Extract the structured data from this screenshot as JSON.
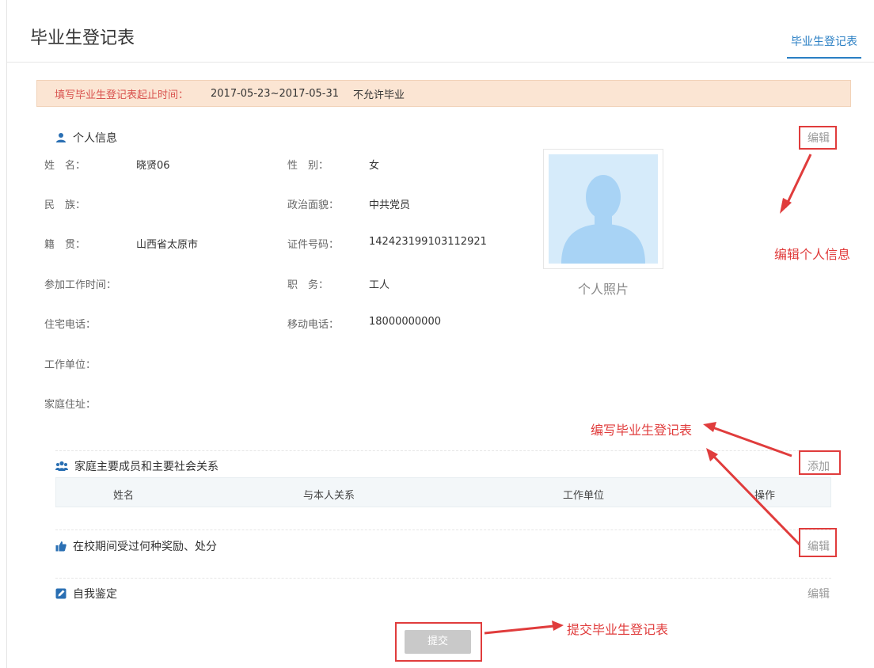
{
  "page": {
    "title": "毕业生登记表",
    "tab": "毕业生登记表"
  },
  "notice": {
    "label": "填写毕业生登记表起止时间：",
    "dates": "2017-05-23~2017-05-31",
    "status": "不允许毕业"
  },
  "personal": {
    "heading": "个人信息",
    "edit": "编辑",
    "photo_caption": "个人照片",
    "fields": {
      "name_label": "姓　名：",
      "name_value": "晓贤06",
      "gender_label": "性　别：",
      "gender_value": "女",
      "ethnicity_label": "民　族：",
      "politics_label": "政治面貌：",
      "politics_value": "中共党员",
      "origin_label": "籍　贯：",
      "origin_value": "山西省太原市",
      "id_label": "证件号码：",
      "id_value": "142423199103112921",
      "work_start_label": "参加工作时间：",
      "position_label": "职　务：",
      "position_value": "工人",
      "home_phone_label": "住宅电话：",
      "mobile_label": "移动电话：",
      "mobile_value": "18000000000",
      "employer_label": "工作单位：",
      "address_label": "家庭住址："
    }
  },
  "family": {
    "heading": "家庭主要成员和主要社会关系",
    "add": "添加",
    "columns": [
      "姓名",
      "与本人关系",
      "工作单位",
      "操作"
    ]
  },
  "awards": {
    "heading": "在校期间受过何种奖励、处分",
    "edit": "编辑"
  },
  "self_eval": {
    "heading": "自我鉴定",
    "edit": "编辑"
  },
  "submit": {
    "label": "提交"
  },
  "annotations": {
    "edit_personal": "编辑个人信息",
    "fill_form": "编写毕业生登记表",
    "submit_form": "提交毕业生登记表"
  },
  "colors": {
    "accent": "#2a7fc4",
    "annotation": "#e03c3c",
    "notice_bg": "#fbe5d3",
    "icon_blue": "#2a6fb3"
  }
}
